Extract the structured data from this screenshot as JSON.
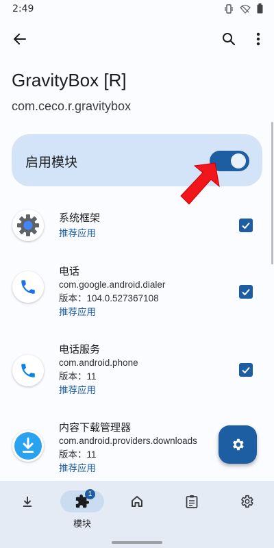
{
  "status": {
    "time": "2:49"
  },
  "header": {
    "title": "GravityBox [R]",
    "package": "com.ceco.r.gravitybox"
  },
  "enable": {
    "label": "启用模块",
    "enabled": true
  },
  "apps": [
    {
      "name": "系统框架",
      "package": "",
      "version": "",
      "tag": "推荐应用",
      "checked": true,
      "icon": "gear-icon"
    },
    {
      "name": "电话",
      "package": "com.google.android.dialer",
      "version": "版本：104.0.527367108",
      "tag": "推荐应用",
      "checked": true,
      "icon": "phone-icon"
    },
    {
      "name": "电话服务",
      "package": "com.android.phone",
      "version": "版本：11",
      "tag": "推荐应用",
      "checked": true,
      "icon": "phone-icon"
    },
    {
      "name": "内容下载管理器",
      "package": "com.android.providers.downloads",
      "version": "版本：11",
      "tag": "推荐应用",
      "checked": true,
      "icon": "download-icon"
    }
  ],
  "nav": {
    "modules_label": "模块",
    "modules_badge": "1"
  },
  "colors": {
    "accent": "#1d5ea2",
    "card": "#d3e4f8",
    "tag": "#2160a8",
    "nav_bg": "#e4ebf5"
  }
}
